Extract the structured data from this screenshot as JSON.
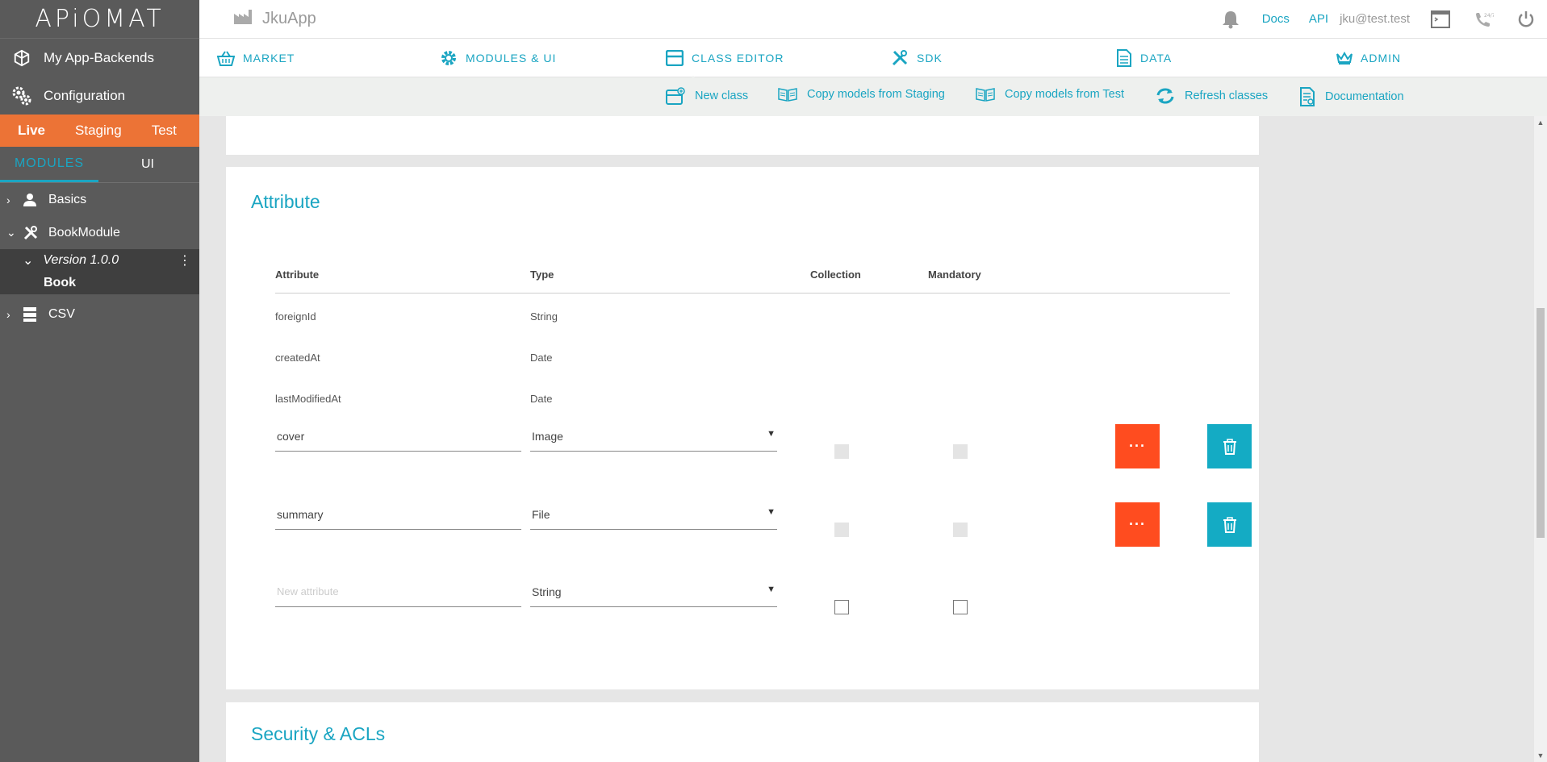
{
  "brand": {
    "logo_text": "APiOMAT"
  },
  "sidebar": {
    "links": [
      {
        "label": "My App-Backends",
        "icon": "cube-icon"
      },
      {
        "label": "Configuration",
        "icon": "gears-icon"
      }
    ],
    "environments": [
      "Live",
      "Staging",
      "Test"
    ],
    "active_environment": "Live",
    "module_tabs": [
      "MODULES",
      "UI"
    ],
    "active_module_tab": "MODULES",
    "tree": {
      "basics": "Basics",
      "bookmodule": "BookModule",
      "version": "Version 1.0.0",
      "class": "Book",
      "csv": "CSV"
    }
  },
  "topbar": {
    "app_name": "JkuApp",
    "docs": "Docs",
    "api": "API",
    "user": "jku@test.test"
  },
  "nav": {
    "items": [
      "MARKET",
      "MODULES & UI",
      "CLASS EDITOR",
      "SDK",
      "DATA",
      "ADMIN"
    ],
    "active": "CLASS EDITOR"
  },
  "toolbar": {
    "new_class": "New class",
    "copy_staging": "Copy models from Staging",
    "copy_test": "Copy models from Test",
    "refresh": "Refresh classes",
    "documentation": "Documentation"
  },
  "attributes": {
    "title": "Attribute",
    "headers": {
      "attribute": "Attribute",
      "type": "Type",
      "collection": "Collection",
      "mandatory": "Mandatory"
    },
    "readonly_rows": [
      {
        "name": "foreignId",
        "type": "String"
      },
      {
        "name": "createdAt",
        "type": "Date"
      },
      {
        "name": "lastModifiedAt",
        "type": "Date"
      }
    ],
    "editable_rows": [
      {
        "name": "cover",
        "type": "Image",
        "more_label": "···"
      },
      {
        "name": "summary",
        "type": "File",
        "more_label": "···"
      }
    ],
    "new_row": {
      "placeholder": "New attribute",
      "type": "String"
    },
    "colors": {
      "more_button": "#ff4c1f",
      "delete_button": "#14abc4",
      "accent": "#1aa5c2"
    }
  },
  "security": {
    "title": "Security & ACLs"
  }
}
